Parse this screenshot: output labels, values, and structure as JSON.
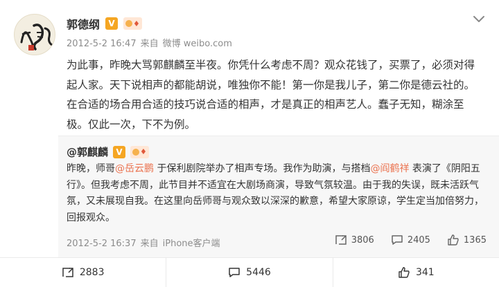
{
  "post": {
    "author": "郭德纲",
    "verified_badge": "V",
    "level_badge": "♦",
    "time": "2012-5-2 16:47",
    "source_prefix": "来自",
    "source": "微博 weibo.com",
    "text": "为此事，昨晚大骂郭麒麟至半夜。你凭什么考虑不周？观众花钱了，买票了，必须对得起人家。天下说相声的都能胡说，唯独你不能！第一你是我儿子，第二你是德云社的。在合适的场合用合适的技巧说合适的相声，才是真正的相声艺人。蠢子无知，糊涂至极。仅此一次，下不为例。"
  },
  "repost": {
    "author": "@郭麒麟",
    "verified_badge": "V",
    "level_badge": "♦",
    "text_1": "昨晚，师哥",
    "mention_1": "@岳云鹏",
    "text_2": " 于保利剧院举办了相声专场。我作为助演，与搭档",
    "mention_2": "@阎鹤祥",
    "text_3": " 表演了《阴阳五行》。但我考虑不周，此节目并不适宜在大剧场商演，导致气氛较温。由于我的失误，既未活跃气氛，又未展现自我。在这里向岳师哥与观众致以深深的歉意，希望大家原谅，学生定当加倍努力，回报观众。",
    "time": "2012-5-2 16:37",
    "source_prefix": "来自",
    "source": "iPhone客户端",
    "reposts": "3806",
    "comments": "2405",
    "likes": "1365"
  },
  "actions": {
    "reposts": "2883",
    "comments": "5446",
    "likes": "341"
  },
  "colors": {
    "mention": "#eb7350",
    "verified": "#f5a623",
    "meta": "#8c8c8c"
  },
  "icons": [
    "avatar-calligraphy",
    "verified-v-icon",
    "level-badge-icon",
    "chevron-down-icon",
    "repost-icon",
    "comment-icon",
    "like-icon"
  ]
}
